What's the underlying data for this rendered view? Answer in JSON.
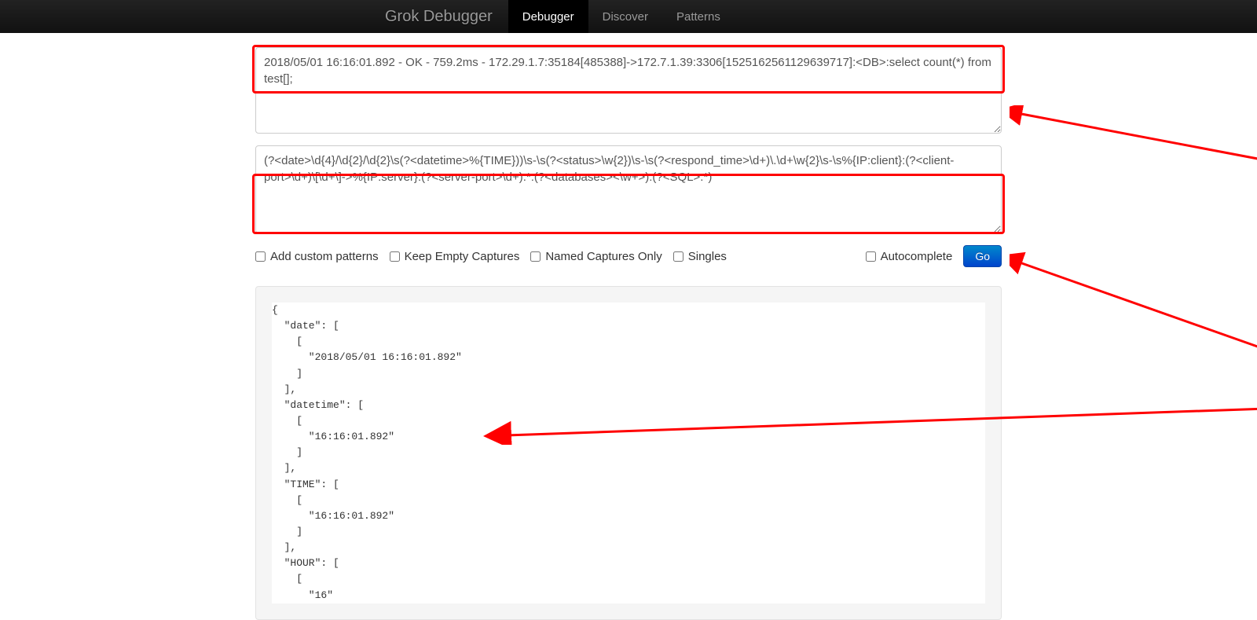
{
  "navbar": {
    "brand": "Grok Debugger",
    "items": [
      {
        "label": "Debugger",
        "active": true
      },
      {
        "label": "Discover",
        "active": false
      },
      {
        "label": "Patterns",
        "active": false
      }
    ]
  },
  "input_log": "2018/05/01 16:16:01.892 - OK - 759.2ms - 172.29.1.7:35184[485388]->172.7.1.39:3306[1525162561129639717]:<DB>:select count(*) from test[];",
  "underlined_span": "759.2ms",
  "pattern": "(?<date>\\d{4}/\\d{2}/\\d{2}\\s(?<datetime>%{TIME}))\\s-\\s(?<status>\\w{2})\\s-\\s(?<respond_time>\\d+)\\.\\d+\\w{2}\\s-\\s%{IP:client}:(?<client-port>\\d+)\\[\\d+\\]->%{IP:server}:(?<server-port>\\d+).*:(?<databases><\\w+>):(?<SQL>.*)",
  "options": {
    "add_custom": "Add custom patterns",
    "keep_empty": "Keep Empty Captures",
    "named_only": "Named Captures Only",
    "singles": "Singles",
    "autocomplete": "Autocomplete",
    "go_label": "Go"
  },
  "result_json": "{\n  \"date\": [\n    [\n      \"2018/05/01 16:16:01.892\"\n    ]\n  ],\n  \"datetime\": [\n    [\n      \"16:16:01.892\"\n    ]\n  ],\n  \"TIME\": [\n    [\n      \"16:16:01.892\"\n    ]\n  ],\n  \"HOUR\": [\n    [\n      \"16\""
}
